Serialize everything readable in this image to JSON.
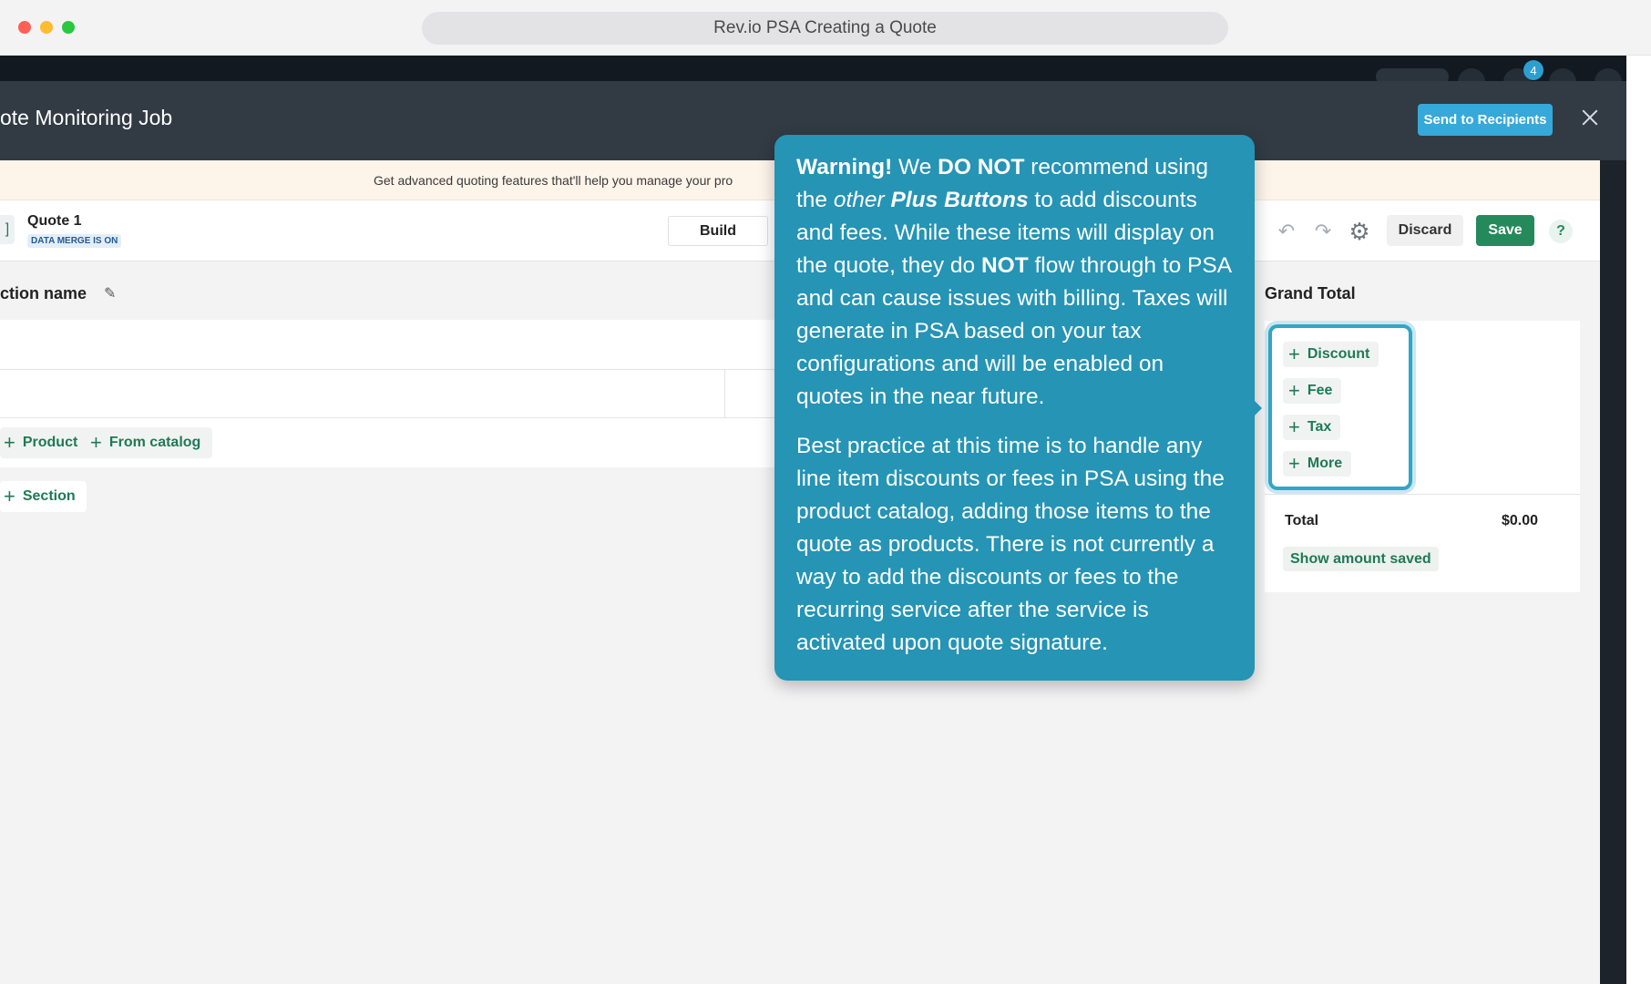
{
  "browser": {
    "tab_title": "Rev.io PSA Creating a Quote"
  },
  "app": {
    "notification_count": "4"
  },
  "modal": {
    "title": "ote Monitoring Job",
    "send_button": "Send to Recipients"
  },
  "banner": {
    "text": "Get advanced quoting features that'll help you manage your pro"
  },
  "toolbar": {
    "edge_glyph": "]",
    "quote_name": "Quote 1",
    "data_merge_badge": "DATA MERGE IS ON",
    "build_tab": "Build",
    "discard_button": "Discard",
    "save_button": "Save",
    "help_glyph": "?"
  },
  "editor": {
    "section_name": "ction name",
    "product_button": "Product",
    "from_catalog_button": "From catalog",
    "section_button": "Section"
  },
  "grand_total": {
    "title": "Grand Total",
    "items": [
      "Discount",
      "Fee",
      "Tax",
      "More"
    ],
    "total_label": "Total",
    "total_value": "$0.00",
    "show_saved_button": "Show amount saved"
  },
  "tooltip": {
    "p1_warning": "Warning!",
    "p1_t1": " We ",
    "p1_do_not": "DO NOT",
    "p1_t2": " recommend using the ",
    "p1_other": "other",
    "p1_plus_buttons": "Plus Buttons",
    "p1_t3": " to add discounts and fees. While these items will display on the quote, they do ",
    "p1_not": "NOT",
    "p1_t4": " flow through to PSA and can cause issues with billing. Taxes will generate in PSA based on your tax configurations and will be enabled on quotes in the near future.",
    "p2": "Best practice at this time is to handle any line item discounts or fees in PSA using the product catalog, adding those items to the quote as products. There is not currently a way to add the discounts or fees to the recurring service after the service is activated upon quote signature."
  },
  "colors": {
    "accent_green": "#258a5b",
    "tooltip_blue": "#2594b5",
    "send_blue": "#35a9da"
  }
}
